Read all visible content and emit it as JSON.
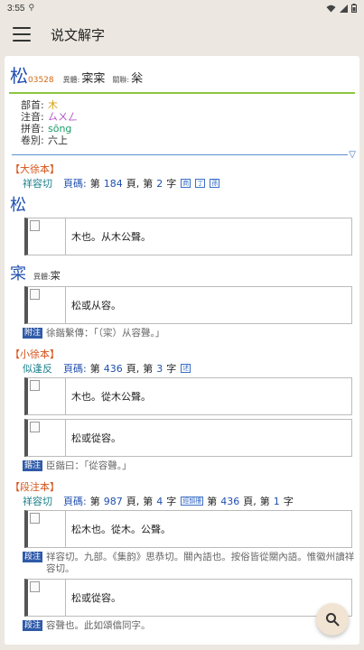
{
  "status": {
    "time": "3:55"
  },
  "appbar": {
    "title": "说文解字"
  },
  "head": {
    "char": "松",
    "num": "03528",
    "variant_label": "異體:",
    "variant_value": "寀寀",
    "related_label": "關聯:",
    "related_value": "枀"
  },
  "info": {
    "bushou_k": "部首:",
    "bushou_v": "木",
    "zhuyin_k": "注音:",
    "zhuyin_v": "ㄙㄨㄥ",
    "pinyin_k": "拼音:",
    "pinyin_v": "sōng",
    "juan_k": "卷別:",
    "juan_v": "六上"
  },
  "da": {
    "title": "【大徐本】",
    "fanqie": "祥容切",
    "page_k": "頁碼:",
    "d_di": "第",
    "d_page": "184",
    "d_ye": "頁,",
    "d_di2": "第",
    "d_zi_num": "2",
    "d_zi": "字",
    "tags": [
      "商",
      "丁",
      "孫"
    ],
    "char1": "松",
    "text1": "木也。从木公聲。",
    "char2": "寀",
    "variant_label": "異體:",
    "variant_value": "寀",
    "text2": "松或从容。",
    "note_label": "附注",
    "note": "徐鍇繫傳：「（寀）从容聲。」"
  },
  "xiao": {
    "title": "【小徐本】",
    "fanqie": "似逢反",
    "page_k": "頁碼:",
    "d_di": "第",
    "d_page": "436",
    "d_ye": "頁,",
    "d_di2": "第",
    "d_zi_num": "3",
    "d_zi": "字",
    "tags": [
      "述"
    ],
    "text1": "木也。從木公聲。",
    "text2": "松或從容。",
    "note_label": "鍇注",
    "note": "臣鍇曰：「從容聲。」"
  },
  "duan": {
    "title": "【段注本】",
    "fanqie": "祥容切",
    "page_k": "頁碼:",
    "d_di": "第",
    "d_page": "987",
    "d_ye": "頁,",
    "d_di2": "第",
    "d_zi_num": "4",
    "d_zi": "字",
    "tag": "經韻樓",
    "e_di": "第",
    "e_page": "436",
    "e_ye": "頁,",
    "e_di2": "第",
    "e_zi_num": "1",
    "e_zi": "字",
    "text1": "松木也。從木。公聲。",
    "note1_label": "段注",
    "note1": "祥容切。九部。《集韵》思恭切。關內語也。按俗皆從關內語。惟徽州讀祥容切。",
    "text2": "松或從容。",
    "note2_label": "段注",
    "note2": "容聲也。此如頌㒆同字。"
  }
}
